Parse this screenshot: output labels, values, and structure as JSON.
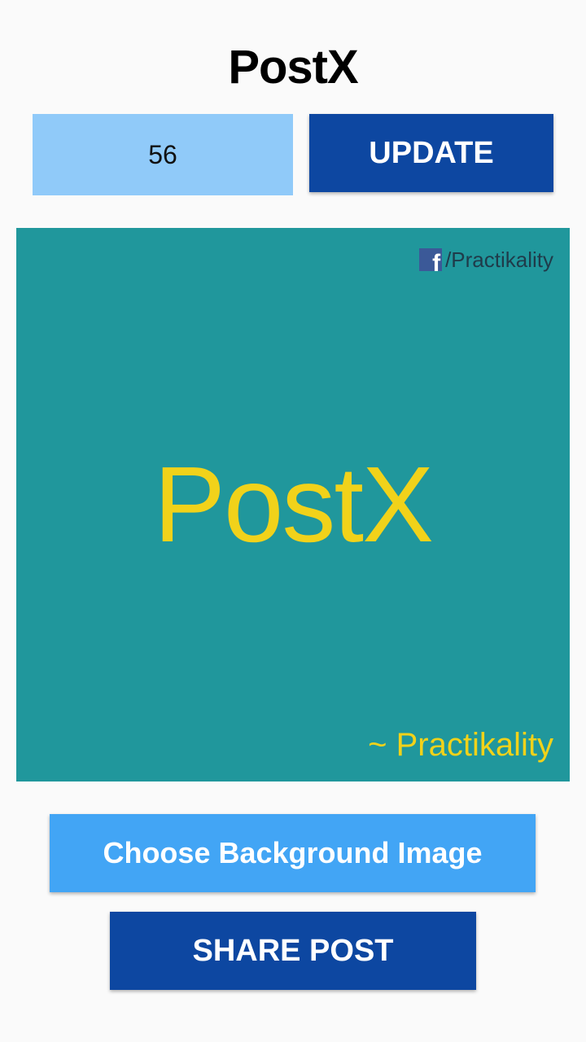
{
  "app": {
    "title": "PostX"
  },
  "controls": {
    "font_size_value": "56",
    "update_label": "UPDATE"
  },
  "post": {
    "facebook_handle": "/Practikality",
    "headline": "PostX",
    "signature": "~ Practikality",
    "background_color": "#20979c",
    "text_color": "#f1d21a",
    "facebook_icon": "facebook-icon"
  },
  "actions": {
    "choose_background_label": "Choose Background Image",
    "share_label": "SHARE POST"
  },
  "colors": {
    "primary_dark": "#0d47a1",
    "primary_light": "#42a5f5",
    "input_bg": "#90caf9"
  }
}
